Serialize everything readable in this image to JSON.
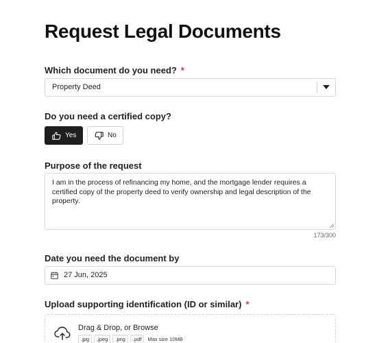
{
  "page": {
    "title": "Request Legal Documents"
  },
  "document_field": {
    "label": "Which document do you need?",
    "required_marker": "*",
    "selected_value": "Property Deed"
  },
  "certified_field": {
    "label": "Do you need a certified copy?",
    "yes_label": "Yes",
    "no_label": "No",
    "selected": "Yes"
  },
  "purpose_field": {
    "label": "Purpose of the request",
    "value": "I am in the process of refinancing my home, and the mortgage lender requires a certified copy of the property deed to verify ownership and legal description of the property.",
    "char_count": "173/300"
  },
  "date_field": {
    "label": "Date you need the document by",
    "value": "27 Jun, 2025"
  },
  "upload_field": {
    "label": "Upload supporting identification (ID or similar)",
    "required_marker": "*",
    "title": "Drag & Drop, or Browse",
    "file_types": [
      ".jpg",
      ".jpeg",
      ".png",
      ".pdf"
    ],
    "max_size": "Max size 10MB"
  },
  "icons": {
    "yes_button_icon": "thumbs-up-icon",
    "no_button_icon": "thumbs-down-icon",
    "select_icon": "caret-down-icon",
    "date_icon": "calendar-icon",
    "upload_icon": "cloud-upload-icon"
  },
  "colors": {
    "required": "#e0306a",
    "selected_button_bg": "#1e1e1e"
  }
}
